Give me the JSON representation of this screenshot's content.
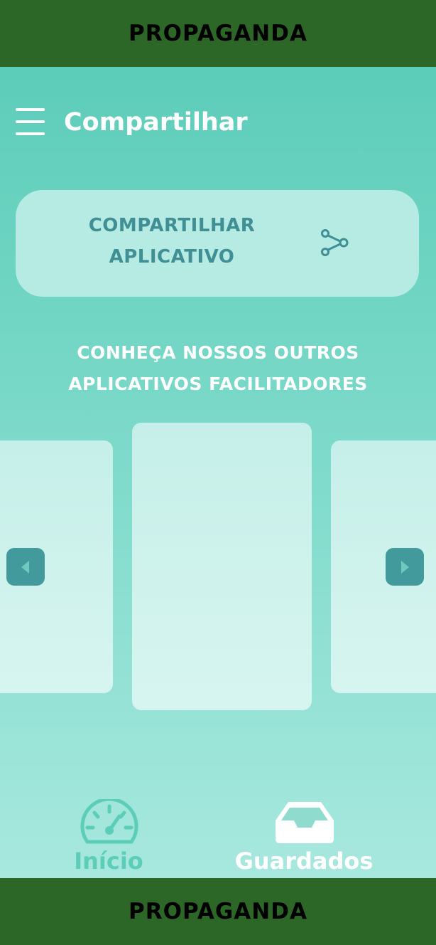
{
  "ads": {
    "top_label": "PROPAGANDA",
    "bottom_label": "PROPAGANDA"
  },
  "header": {
    "menu_icon": "hamburger-menu-icon",
    "title": "Compartilhar"
  },
  "share_card": {
    "line1": "COMPARTILHAR",
    "line2": "APLICATIVO",
    "icon": "share-icon"
  },
  "apps_section": {
    "line1": "CONHEÇA NOSSOS OUTROS",
    "line2": "APLICATIVOS FACILITADORES"
  },
  "carousel": {
    "prev_icon": "chevron-left-icon",
    "next_icon": "chevron-right-icon"
  },
  "bottom_nav": {
    "items": [
      {
        "label": "Início",
        "icon": "speedometer-icon"
      },
      {
        "label": "Guardados",
        "icon": "inbox-tray-icon"
      }
    ]
  },
  "colors": {
    "ad_bar": "#2d6727",
    "gradient_top": "#5ccdb9",
    "gradient_bottom": "#a8e8de",
    "accent_dark": "#429a9d",
    "share_text": "#3f8f95",
    "card": "#b6ebe4"
  }
}
